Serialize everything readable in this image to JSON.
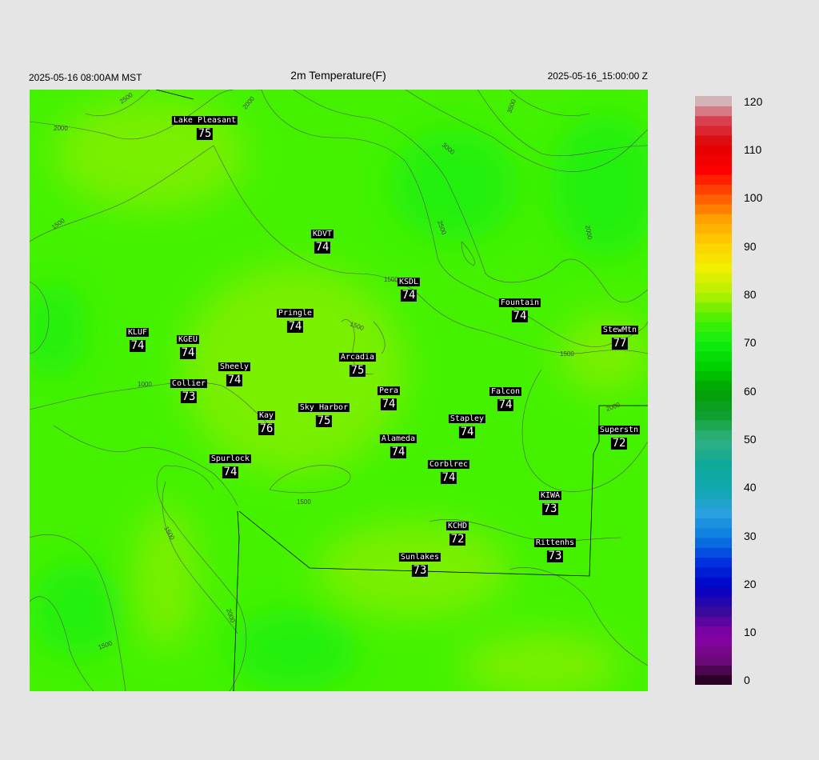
{
  "header": {
    "left_time": "2025-05-16 08:00AM MST",
    "title": "2m Temperature(F)",
    "right_time": "2025-05-16_15:00:00 Z"
  },
  "colors": {
    "field_base": "#44f200",
    "field_warm": "#78f000",
    "field_cool": "#22f008",
    "label_bg": "#000000",
    "label_fg": "#ffffff",
    "contour": "#555555",
    "boundary": "#000000"
  },
  "contour_labels": [
    "2500",
    "2000",
    "3500",
    "3000",
    "2000",
    "2500",
    "2000",
    "1500",
    "1500",
    "1500",
    "1000",
    "1500",
    "1500",
    "2000",
    "1500",
    "1500",
    "2000"
  ],
  "stations": [
    {
      "name": "Lake Pleasant",
      "value": "75"
    },
    {
      "name": "KDVT",
      "value": "74"
    },
    {
      "name": "KSDL",
      "value": "74"
    },
    {
      "name": "Fountain",
      "value": "74"
    },
    {
      "name": "StewMtn",
      "value": "77"
    },
    {
      "name": "Pringle",
      "value": "74"
    },
    {
      "name": "KLUF",
      "value": "74"
    },
    {
      "name": "KGEU",
      "value": "74"
    },
    {
      "name": "Arcadia",
      "value": "75"
    },
    {
      "name": "Sheely",
      "value": "74"
    },
    {
      "name": "Collier",
      "value": "73"
    },
    {
      "name": "Pera",
      "value": "74"
    },
    {
      "name": "Falcon",
      "value": "74"
    },
    {
      "name": "Kay",
      "value": "76"
    },
    {
      "name": "Sky Harbor",
      "value": "75"
    },
    {
      "name": "Stapley",
      "value": "74"
    },
    {
      "name": "Superstn",
      "value": "72"
    },
    {
      "name": "Alameda",
      "value": "74"
    },
    {
      "name": "Spurlock",
      "value": "74"
    },
    {
      "name": "Corblrec",
      "value": "74"
    },
    {
      "name": "KIWA",
      "value": "73"
    },
    {
      "name": "KCHD",
      "value": "72"
    },
    {
      "name": "Rittenhs",
      "value": "73"
    },
    {
      "name": "Sunlakes",
      "value": "73"
    }
  ],
  "colorbar": {
    "min": 0,
    "max": 120,
    "ticks": [
      "120",
      "110",
      "100",
      "90",
      "80",
      "70",
      "60",
      "50",
      "40",
      "30",
      "20",
      "10",
      "0"
    ],
    "stops": [
      {
        "v": 0,
        "c": "#1a0010"
      },
      {
        "v": 5,
        "c": "#6a0a78"
      },
      {
        "v": 10,
        "c": "#8a00a8"
      },
      {
        "v": 15,
        "c": "#3a0a9a"
      },
      {
        "v": 20,
        "c": "#0000c8"
      },
      {
        "v": 25,
        "c": "#0030e0"
      },
      {
        "v": 30,
        "c": "#0a7ae0"
      },
      {
        "v": 35,
        "c": "#2aa0e0"
      },
      {
        "v": 40,
        "c": "#10a8b0"
      },
      {
        "v": 45,
        "c": "#10a898"
      },
      {
        "v": 50,
        "c": "#30b080"
      },
      {
        "v": 55,
        "c": "#10a030"
      },
      {
        "v": 60,
        "c": "#00a000"
      },
      {
        "v": 65,
        "c": "#00d000"
      },
      {
        "v": 70,
        "c": "#10ee10"
      },
      {
        "v": 75,
        "c": "#50f000"
      },
      {
        "v": 80,
        "c": "#b8f000"
      },
      {
        "v": 85,
        "c": "#f0f000"
      },
      {
        "v": 90,
        "c": "#ffd000"
      },
      {
        "v": 95,
        "c": "#ffa000"
      },
      {
        "v": 100,
        "c": "#ff5000"
      },
      {
        "v": 105,
        "c": "#ff0000"
      },
      {
        "v": 110,
        "c": "#e00000"
      },
      {
        "v": 115,
        "c": "#d84050"
      },
      {
        "v": 120,
        "c": "#d0d0d0"
      }
    ]
  }
}
